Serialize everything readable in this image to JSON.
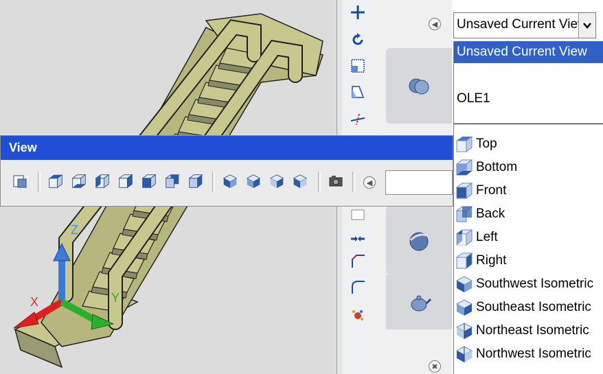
{
  "view_toolbar": {
    "title": "View",
    "buttons": [
      {
        "name": "named-views-icon"
      },
      {
        "name": "top-view-icon"
      },
      {
        "name": "bottom-view-icon"
      },
      {
        "name": "left-view-icon"
      },
      {
        "name": "right-view-icon"
      },
      {
        "name": "front-view-icon"
      },
      {
        "name": "back-view-icon"
      },
      {
        "name": "sw-iso-icon"
      },
      {
        "name": "se-iso-icon"
      },
      {
        "name": "ne-iso-icon"
      },
      {
        "name": "nw-iso-icon"
      },
      {
        "name": "camera-icon"
      }
    ]
  },
  "views_combo": {
    "current_value": "Unsaved Current View"
  },
  "views_list": {
    "items": [
      {
        "label": "Unsaved Current View",
        "icon": "none",
        "selected": true
      },
      {
        "label": "",
        "icon": "none",
        "selected": false
      },
      {
        "label": "OLE1",
        "icon": "none",
        "selected": false
      },
      {
        "label": "Top",
        "icon": "top-view-icon",
        "selected": false
      },
      {
        "label": "Bottom",
        "icon": "bottom-view-icon",
        "selected": false
      },
      {
        "label": "Front",
        "icon": "front-view-icon",
        "selected": false
      },
      {
        "label": "Back",
        "icon": "back-view-icon",
        "selected": false
      },
      {
        "label": "Left",
        "icon": "left-view-icon",
        "selected": false
      },
      {
        "label": "Right",
        "icon": "right-view-icon",
        "selected": false
      },
      {
        "label": "Southwest Isometric",
        "icon": "sw-iso-icon",
        "selected": false
      },
      {
        "label": "Southeast Isometric",
        "icon": "se-iso-icon",
        "selected": false
      },
      {
        "label": "Northeast Isometric",
        "icon": "ne-iso-icon",
        "selected": false
      },
      {
        "label": "Northwest Isometric",
        "icon": "nw-iso-icon",
        "selected": false
      }
    ]
  },
  "ucs_icon": {
    "x_label": "X",
    "y_label": "Y",
    "z_label": "Z"
  },
  "colors": {
    "title_bar": "#1f4fd6",
    "selection": "#3160c6",
    "stair_fill": "#c8c88e",
    "viewport_bg": "#dcdcdc"
  }
}
